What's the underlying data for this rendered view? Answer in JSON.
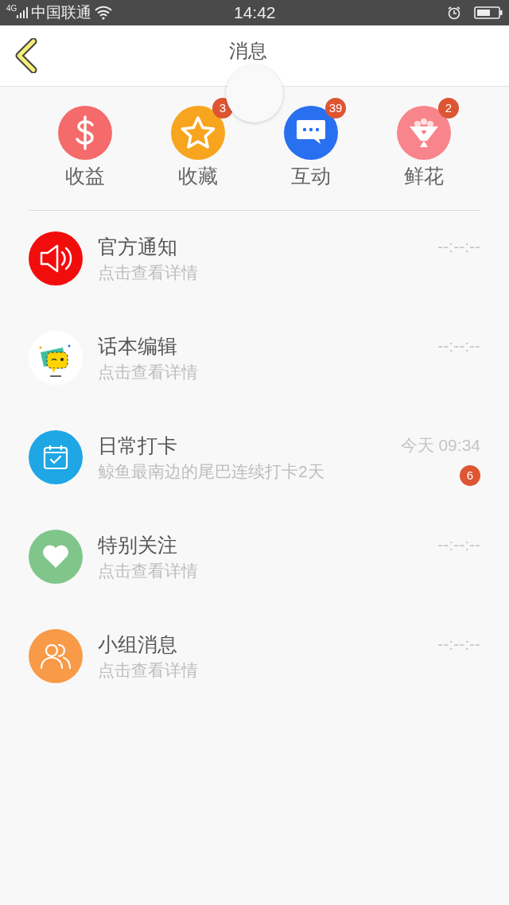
{
  "status_bar": {
    "network": "4G",
    "carrier": "中国联通",
    "time": "14:42"
  },
  "header": {
    "title": "消息"
  },
  "shortcuts": [
    {
      "kind": "income",
      "label": "收益"
    },
    {
      "kind": "favorites",
      "label": "收藏",
      "badge": "3"
    },
    {
      "kind": "interaction",
      "label": "互动",
      "badge": "39"
    },
    {
      "kind": "flowers",
      "label": "鲜花",
      "badge": "2"
    }
  ],
  "messages": [
    {
      "kind": "notice",
      "title": "官方通知",
      "subtitle": "点击查看详情",
      "time": "--:--:--"
    },
    {
      "kind": "editor",
      "title": "话本编辑",
      "subtitle": "点击查看详情",
      "time": "--:--:--"
    },
    {
      "kind": "checkin",
      "title": "日常打卡",
      "subtitle": "鲸鱼最南边的尾巴连续打卡2天",
      "time": "今天 09:34",
      "badge": "6"
    },
    {
      "kind": "follow",
      "title": "特别关注",
      "subtitle": "点击查看详情",
      "time": "--:--:--"
    },
    {
      "kind": "group",
      "title": "小组消息",
      "subtitle": "点击查看详情",
      "time": "--:--:--"
    }
  ]
}
